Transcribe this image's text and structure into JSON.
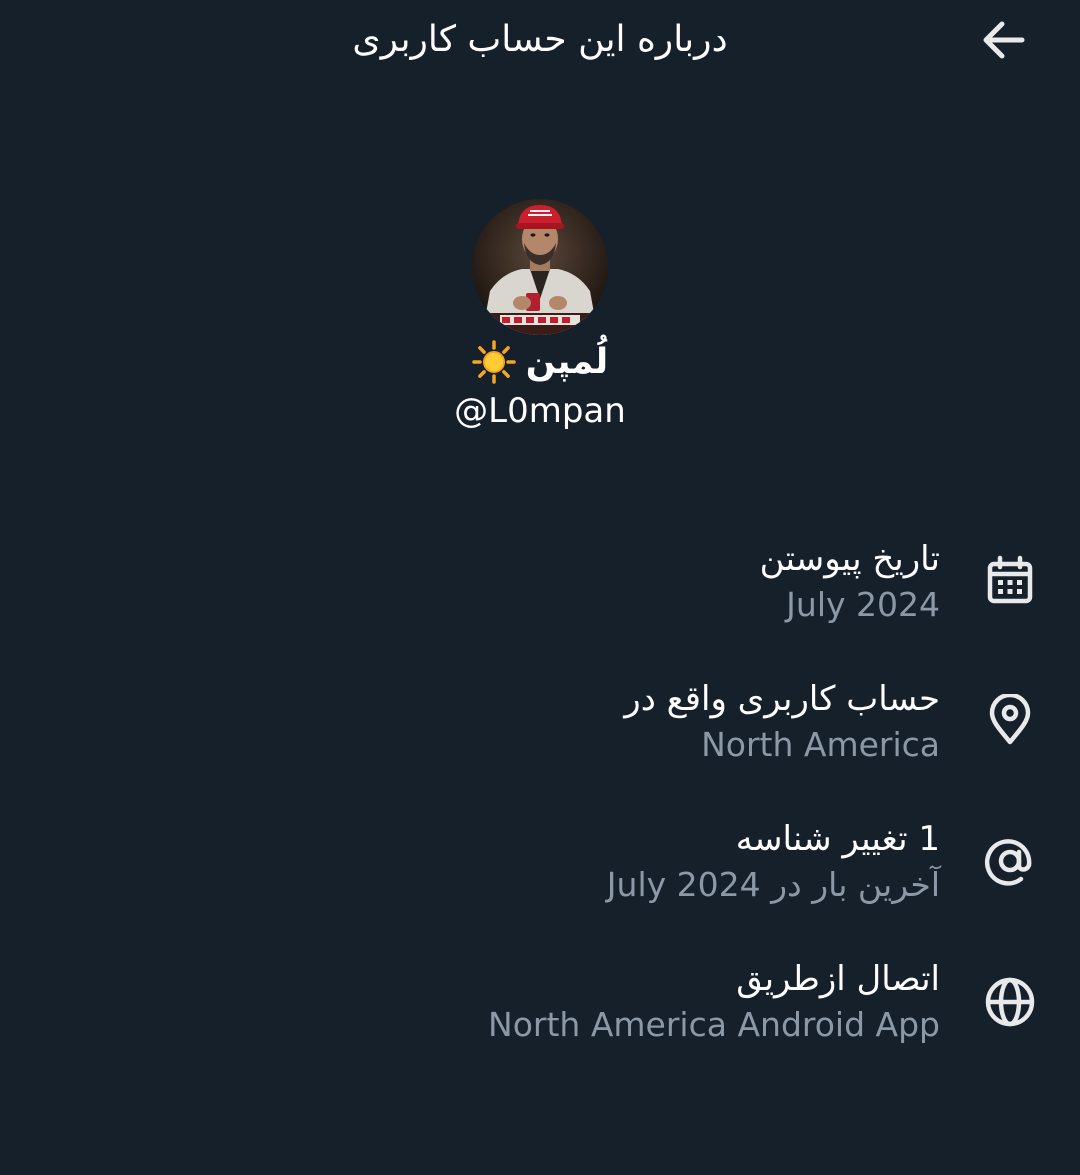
{
  "header": {
    "title": "درباره این حساب کاربری"
  },
  "profile": {
    "display_name": "لُمپن",
    "handle": "@L0mpan",
    "avatar": "user-avatar-photo",
    "name_emoji": "sun-emoji"
  },
  "info": {
    "joined": {
      "title": "تاریخ پیوستن",
      "value": "July 2024",
      "icon": "calendar-icon"
    },
    "location": {
      "title": "حساب کاربری واقع در",
      "value": "North America",
      "icon": "location-pin-icon"
    },
    "username_changes": {
      "title": "1 تغییر شناسه",
      "value_prefix": "آخرین بار در",
      "value_date": "July 2024",
      "icon": "at-sign-icon"
    },
    "connected_via": {
      "title": "اتصال ازطریق",
      "value": "North America Android App",
      "icon": "globe-icon"
    }
  },
  "colors": {
    "background": "#15202b",
    "primary_text": "#ffffff",
    "secondary_text": "#8b98a5"
  }
}
